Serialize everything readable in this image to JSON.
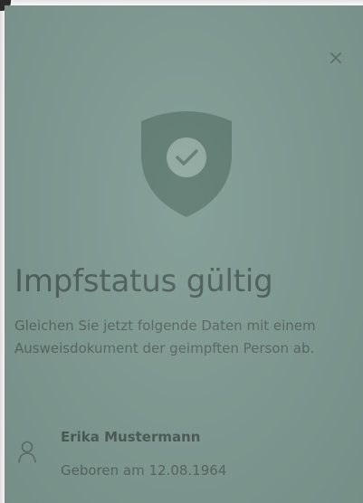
{
  "dialog": {
    "close_icon": "close-icon",
    "status_icon": "shield-check-icon",
    "title": "Impfstatus gültig",
    "description": "Gleichen Sie jetzt folgende Daten mit einem Ausweisdokument der geimpften Person ab."
  },
  "person": {
    "icon": "person-icon",
    "name": "Erika Mustermann",
    "birth_info": "Geboren am 12.08.1964"
  },
  "colors": {
    "screen_background": "#7f9b93",
    "shield": "#5f7b72",
    "check_circle": "#8fa8a0",
    "text_primary": "#4d5f5a",
    "text_secondary": "#56655f"
  }
}
